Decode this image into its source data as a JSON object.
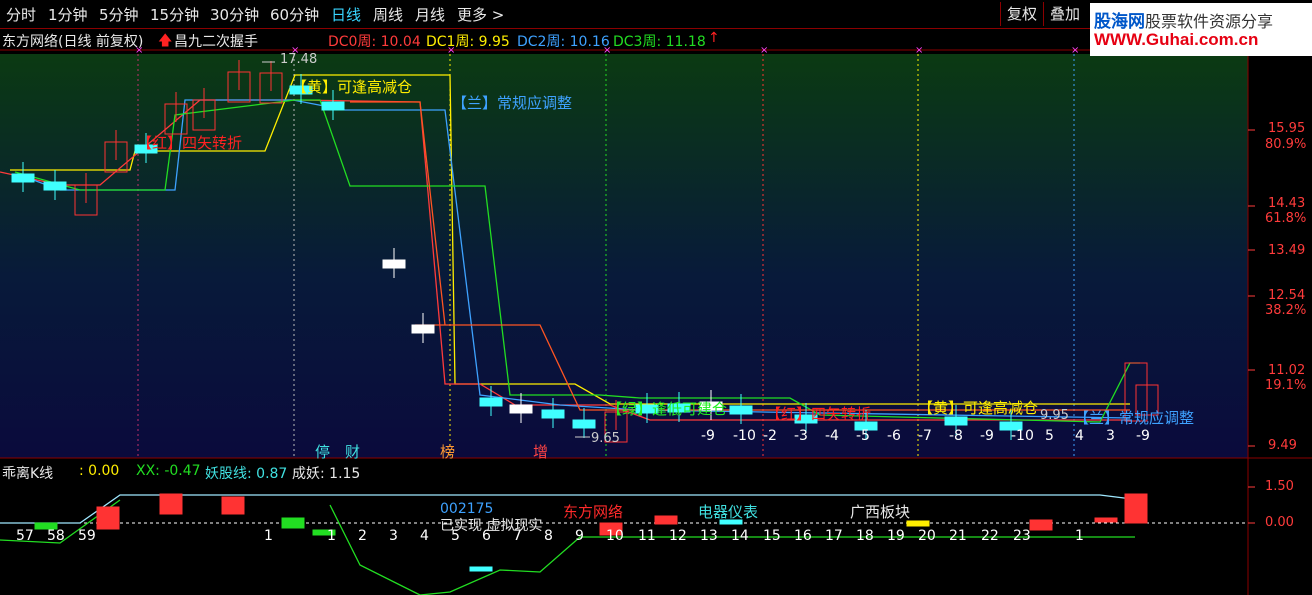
{
  "toolbar": {
    "periods": [
      "分时",
      "1分钟",
      "5分钟",
      "15分钟",
      "30分钟",
      "60分钟",
      "日线",
      "周线",
      "月线",
      "更多 >"
    ],
    "active_period": "日线",
    "restore_label": "复权",
    "overlay_label": "叠加"
  },
  "logo": {
    "site_name": "股海网",
    "tagline": "股票软件资源分享",
    "url": "WWW.Guhai.com.cn"
  },
  "main_chart": {
    "title": "东方网络(日线 前复权)",
    "strategy_label": "昌九二次握手",
    "dc": [
      {
        "label": "DC0周:",
        "value": "10.04",
        "color": "#ff3b3b"
      },
      {
        "label": "DC1周:",
        "value": "9.95",
        "color": "#ffee00"
      },
      {
        "label": "DC2周:",
        "value": "10.16",
        "color": "#3ea2ff"
      },
      {
        "label": "DC3周:",
        "value": "11.18",
        "color": "#22dd22"
      }
    ],
    "high_label": "17.48",
    "low_label": "9.65",
    "price_axis": [
      "15.95",
      "80.9%",
      "14.43",
      "61.8%",
      "13.49",
      "12.54",
      "38.2%",
      "11.02",
      "19.1%",
      "9.49"
    ],
    "signals": [
      {
        "text": "【黄】可逢高减仓",
        "color": "#ffee00"
      },
      {
        "text": "【兰】常规应调整",
        "color": "#3ea2ff"
      },
      {
        "text": "【红】四矢转折",
        "color": "#ff2222"
      },
      {
        "text": "【绿】逢低可建仓",
        "color": "#22ee22"
      },
      {
        "text": "【红】四矢转折",
        "color": "#ff2222"
      },
      {
        "text": "【黄】可逢高减仓",
        "color": "#ffee00"
      },
      {
        "text": "【兰】常规应调整",
        "color": "#3ea2ff"
      }
    ],
    "small_values": [
      "9.95",
      "10",
      "5"
    ],
    "count_labels": [
      "-9",
      "-10",
      "-2",
      "-3",
      "-4",
      "-5",
      "-6",
      "-7",
      "-8",
      "-9",
      "-10",
      "5",
      "4",
      "3",
      "-9"
    ],
    "event_tags": [
      {
        "text": "停",
        "color": "#40e0e0"
      },
      {
        "text": "财",
        "color": "#40e0e0"
      },
      {
        "text": "榜",
        "color": "#ff9933"
      },
      {
        "text": "增",
        "color": "#ff4444"
      }
    ]
  },
  "sub_chart": {
    "title": "乖离K线",
    "value": ": 0.00",
    "xx_label": "XX: -0.47",
    "yaogu_label": "妖股线: 0.87",
    "chengyao_label": "成妖: 1.15",
    "axis": [
      "1.50",
      "0.00"
    ],
    "stock_code": "002175",
    "tags": [
      {
        "text": "已实现 虚拟现实",
        "color": "#e8e8e8"
      },
      {
        "text": "东方网络",
        "color": "#ff2a2a"
      },
      {
        "text": "电器仪表",
        "color": "#40e0e0"
      },
      {
        "text": "广西板块",
        "color": "#e8e8e8"
      }
    ],
    "day_counts": [
      "57",
      "58",
      "59",
      "1",
      "1",
      "2",
      "3",
      "4",
      "5",
      "6",
      "7",
      "8",
      "9",
      "10",
      "11",
      "12",
      "13",
      "14",
      "15",
      "16",
      "17",
      "18",
      "19",
      "20",
      "21",
      "22",
      "23",
      "1"
    ]
  },
  "colors": {
    "red": "#ff2222",
    "yellow": "#ffee00",
    "blue": "#3ea2ff",
    "green": "#22dd22",
    "cyan": "#40ffff",
    "magenta": "#ff44ff"
  }
}
